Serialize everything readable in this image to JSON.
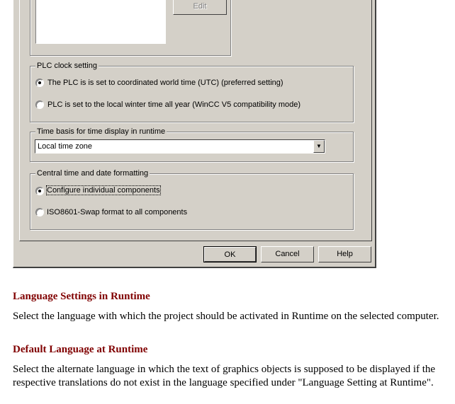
{
  "dialog": {
    "edit_button": "Edit",
    "plc_clock": {
      "legend": "PLC clock setting",
      "options": [
        {
          "label": "The PLC is is set to coordinated world time (UTC) (preferred setting)",
          "selected": true
        },
        {
          "label": "PLC is set to the local winter time all year (WinCC V5 compatibility mode)",
          "selected": false
        }
      ]
    },
    "time_basis": {
      "legend": "Time basis for time display in runtime",
      "value": "Local time zone"
    },
    "formatting": {
      "legend": "Central time and date formatting",
      "options": [
        {
          "label": "Configure individual components",
          "selected": true
        },
        {
          "label": "ISO8601-Swap format to all components",
          "selected": false
        }
      ]
    },
    "buttons": {
      "ok": "OK",
      "cancel": "Cancel",
      "help": "Help"
    }
  },
  "doc": {
    "sections": [
      {
        "heading": "Language Settings in Runtime",
        "text": "Select the language with which the project should be activated in Runtime on the selected computer."
      },
      {
        "heading": "Default Language at Runtime",
        "text": "Select the alternate language in which the text of graphics objects is supposed to be displayed if the respective translations do not exist in the language specified under \"Language Setting at Runtime\"."
      }
    ]
  },
  "colors": {
    "heading": "#800000",
    "dialog_bg": "#d4d0c8"
  }
}
